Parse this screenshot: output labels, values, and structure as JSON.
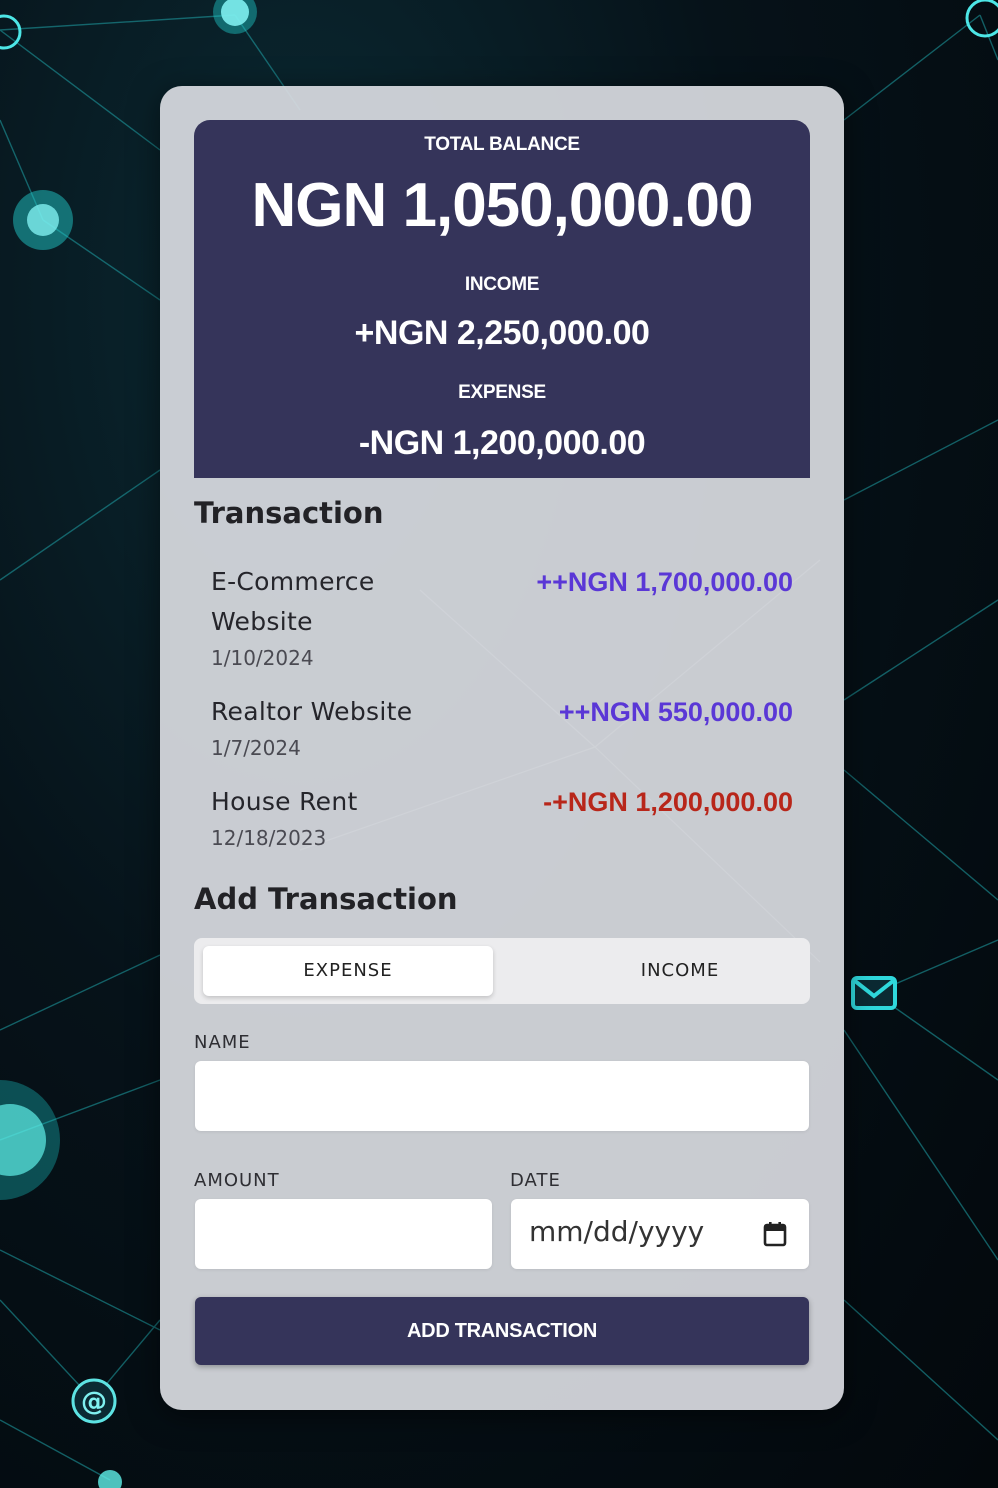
{
  "balance": {
    "total_label": "TOTAL BALANCE",
    "total_value": "NGN 1,050,000.00",
    "income_label": "INCOME",
    "income_value": "+NGN 2,250,000.00",
    "expense_label": "EXPENSE",
    "expense_value": "-NGN 1,200,000.00"
  },
  "transactions": {
    "title": "Transaction",
    "items": [
      {
        "name_line1": "E-Commerce",
        "name_line2": "Website",
        "date": "1/10/2024",
        "amount": "++NGN 1,700,000.00",
        "kind": "income"
      },
      {
        "name_line1": "Realtor Website",
        "date": "1/7/2024",
        "amount": "++NGN 550,000.00",
        "kind": "income"
      },
      {
        "name_line1": "House Rent",
        "date": "12/18/2023",
        "amount": "-+NGN 1,200,000.00",
        "kind": "expense"
      }
    ]
  },
  "add": {
    "title": "Add Transaction",
    "toggle": {
      "expense_label": "EXPENSE",
      "income_label": "INCOME",
      "selected": "EXPENSE"
    },
    "name_label": "NAME",
    "name_value": "",
    "amount_label": "AMOUNT",
    "amount_value": "",
    "date_label": "DATE",
    "date_placeholder": "mm/dd/yyyy",
    "submit_label": "ADD TRANSACTION"
  },
  "colors": {
    "panel": "#35345a",
    "income_amount": "#5a37d6",
    "expense_amount": "#b8261a",
    "accent_glow": "#29d3d3"
  },
  "icons": [
    "calendar-icon",
    "mail-icon",
    "at-sign-icon"
  ]
}
